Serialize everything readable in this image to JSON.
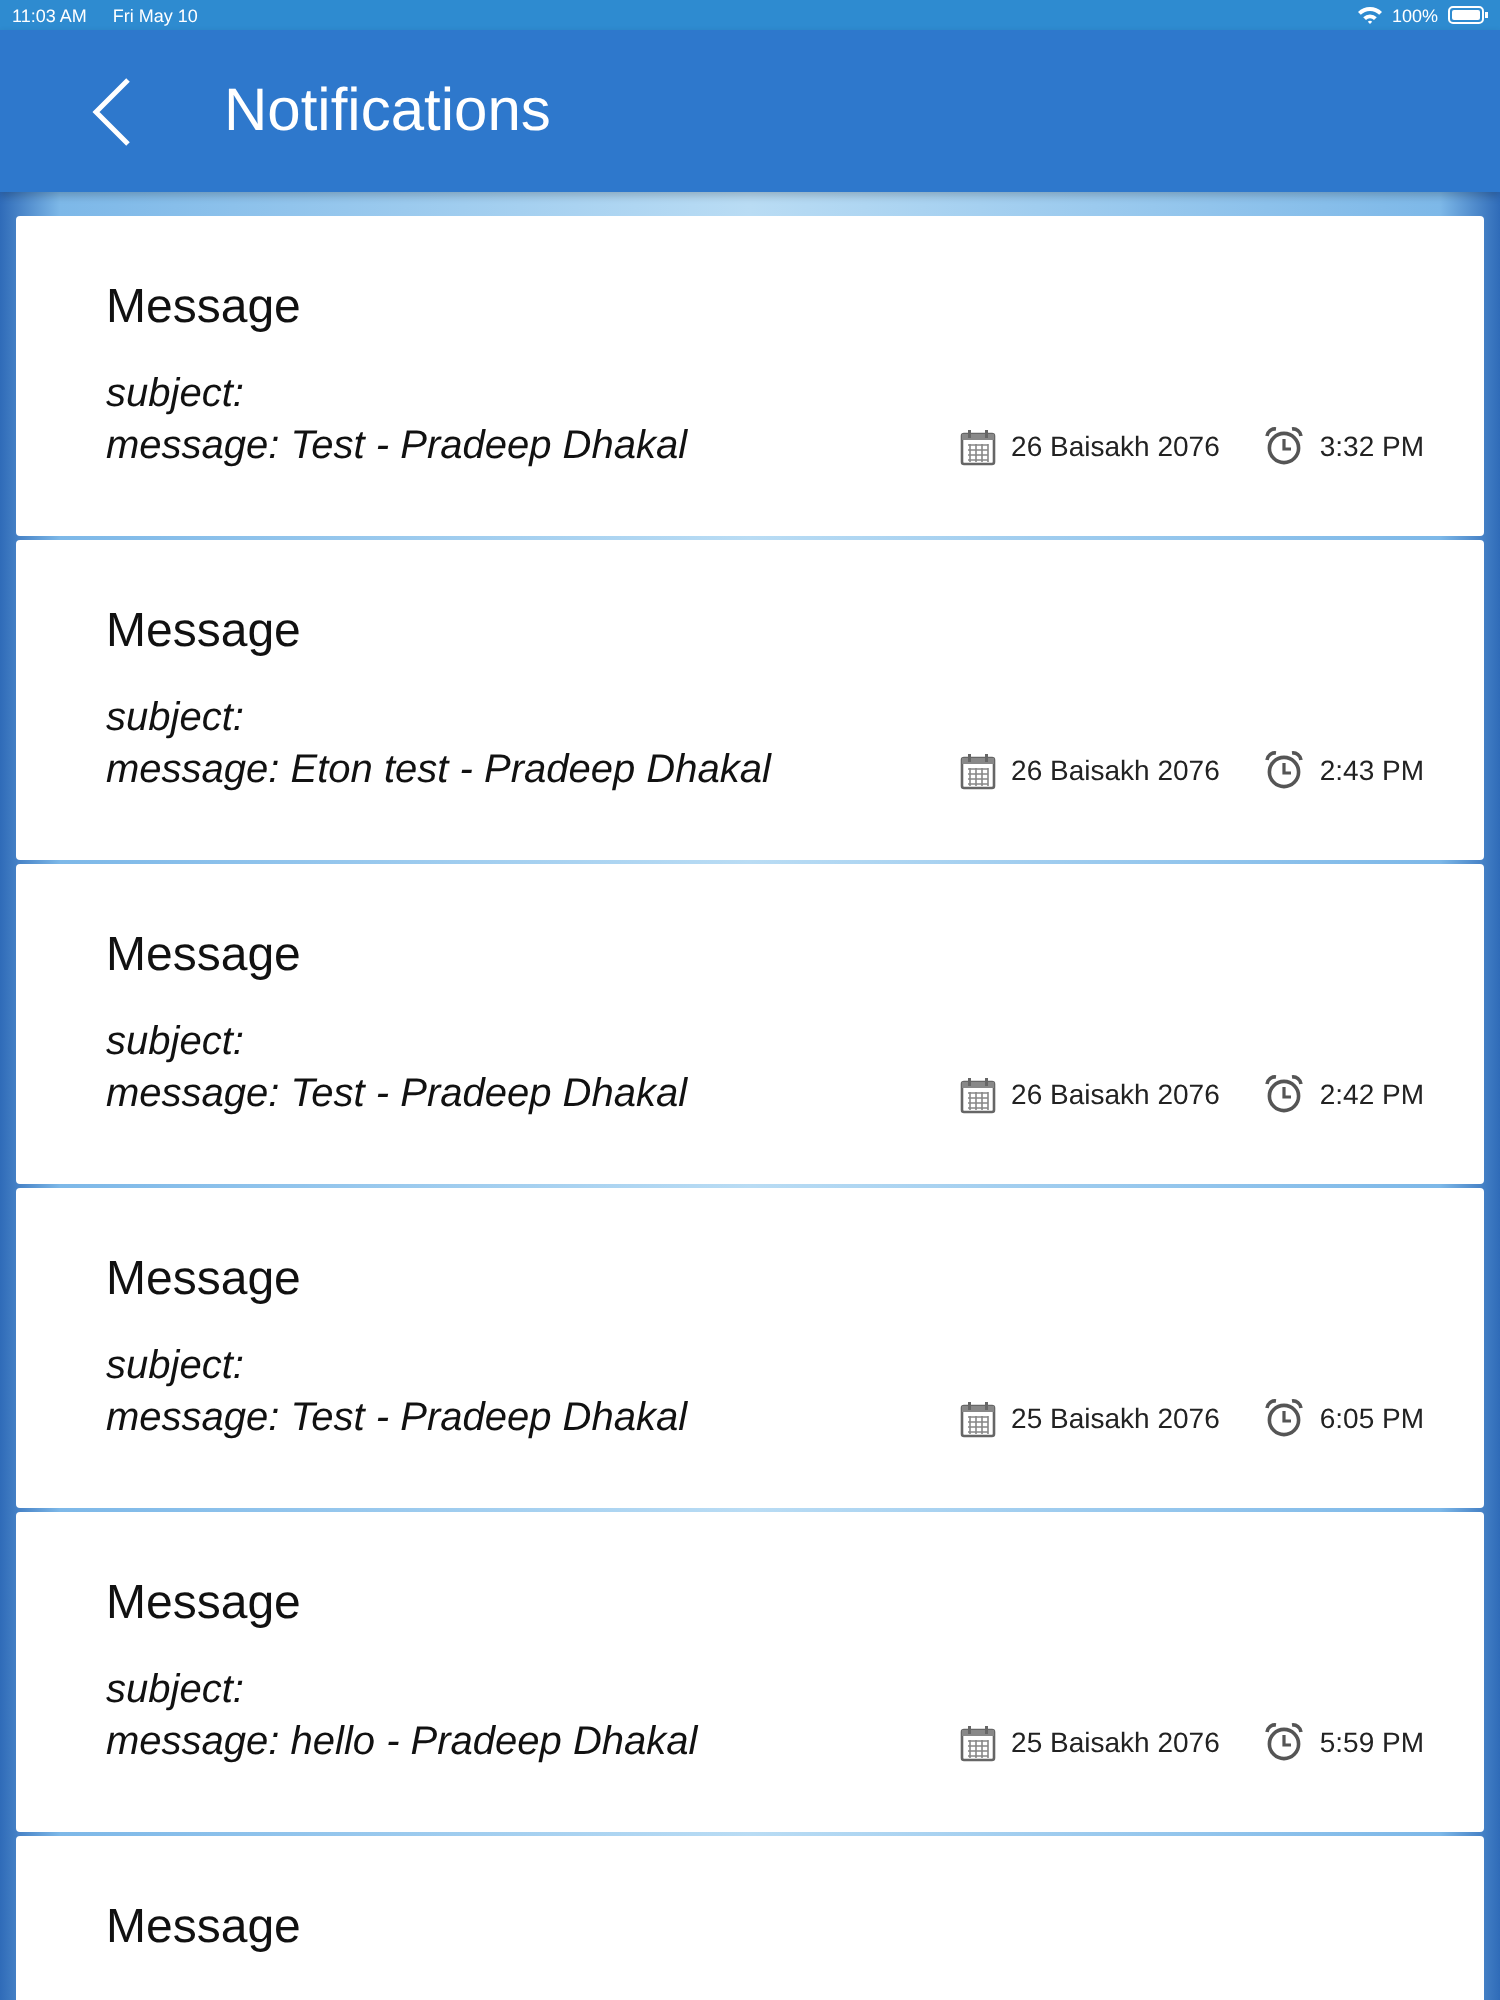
{
  "status_bar": {
    "time": "11:03 AM",
    "date": "Fri May 10",
    "battery": "100%"
  },
  "header": {
    "title": "Notifications"
  },
  "notifications": [
    {
      "title": "Message",
      "subject": "subject:",
      "message": "message: Test - Pradeep Dhakal",
      "date": "26 Baisakh 2076",
      "time": "3:32 PM"
    },
    {
      "title": "Message",
      "subject": "subject:",
      "message": "message: Eton test - Pradeep Dhakal",
      "date": "26 Baisakh 2076",
      "time": "2:43 PM"
    },
    {
      "title": "Message",
      "subject": "subject:",
      "message": "message: Test - Pradeep Dhakal",
      "date": "26 Baisakh 2076",
      "time": "2:42 PM"
    },
    {
      "title": "Message",
      "subject": "subject:",
      "message": "message: Test - Pradeep Dhakal",
      "date": "25 Baisakh 2076",
      "time": "6:05 PM"
    },
    {
      "title": "Message",
      "subject": "subject:",
      "message": "message: hello - Pradeep Dhakal",
      "date": "25 Baisakh 2076",
      "time": "5:59 PM"
    },
    {
      "title": "Message"
    }
  ]
}
